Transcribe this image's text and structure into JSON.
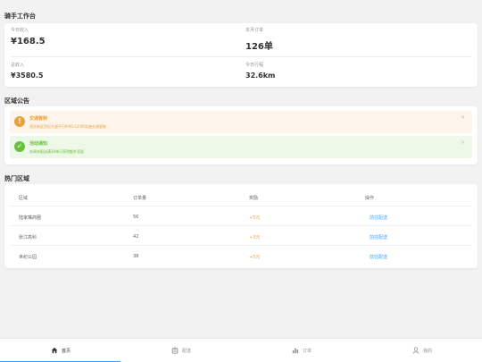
{
  "workbench": {
    "title": "骑手工作台",
    "stats": [
      {
        "label": "今日收入",
        "value": "¥168.5"
      },
      {
        "label": "本月订单",
        "value": "126单"
      },
      {
        "label": "总收入",
        "value": "¥3580.5"
      },
      {
        "label": "今日行程",
        "value": "32.6km"
      }
    ]
  },
  "notices": {
    "title": "区域公告",
    "items": [
      {
        "type": "warning",
        "icon": "exclamation-icon",
        "title": "交通管制",
        "text": "滨东新区世纪大道平日9:00-12:00实施交通管制",
        "close": "×"
      },
      {
        "type": "success",
        "icon": "check-icon",
        "title": "活动通知",
        "text": "本周末配送满20单可获得额外奖励",
        "close": "×"
      }
    ]
  },
  "hot_areas": {
    "title": "热门区域",
    "columns": [
      "区域",
      "订单量",
      "奖励",
      "操作"
    ],
    "rows": [
      {
        "area": "陆家嘴商圈",
        "orders": "56",
        "reward": "+5元",
        "action": "前往配送"
      },
      {
        "area": "张江高科",
        "orders": "42",
        "reward": "+3元",
        "action": "前往配送"
      },
      {
        "area": "世纪公园",
        "orders": "38",
        "reward": "+5元",
        "action": "前往配送"
      }
    ]
  },
  "tabbar": {
    "tabs": [
      {
        "label": "首页",
        "icon": "home-icon"
      },
      {
        "label": "配送",
        "icon": "delivery-icon"
      },
      {
        "label": "订单",
        "icon": "chart-icon"
      },
      {
        "label": "我的",
        "icon": "user-icon"
      }
    ],
    "active": "首页"
  },
  "colors": {
    "warning": "#e6a23c",
    "success": "#67c23a",
    "link": "#409eff",
    "background": "#f2f2f2"
  }
}
